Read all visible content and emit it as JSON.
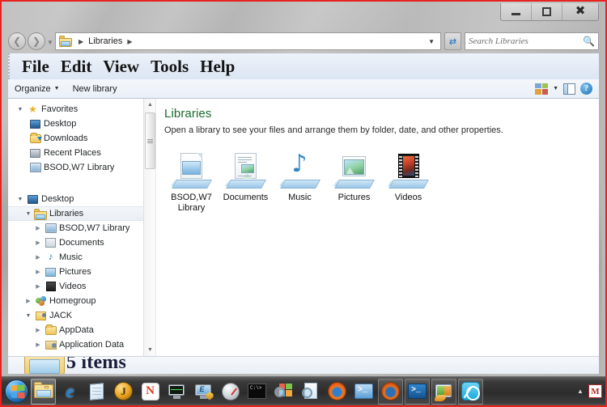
{
  "window": {
    "titlebar": {
      "minimize_label": "Minimize",
      "maximize_label": "Restore",
      "close_label": "Close"
    }
  },
  "address_bar": {
    "back_label": "Back",
    "forward_label": "Forward",
    "breadcrumb": [
      "Libraries"
    ],
    "crumb_text": "Libraries",
    "refresh_label": "Refresh",
    "search": {
      "placeholder": "Search Libraries",
      "value": ""
    }
  },
  "menu_bar": {
    "items": [
      {
        "label": "File"
      },
      {
        "label": "Edit"
      },
      {
        "label": "View"
      },
      {
        "label": "Tools"
      },
      {
        "label": "Help"
      }
    ]
  },
  "toolbar": {
    "organize_label": "Organize",
    "new_library_label": "New library",
    "view_icon": "view-layout-icon",
    "preview_pane_icon": "preview-pane-icon",
    "help_icon": "help-icon",
    "help_glyph": "?"
  },
  "sidebar": {
    "items": [
      {
        "label": "Favorites",
        "icon": "star-icon",
        "indent": 0,
        "expander": "open",
        "selected": false
      },
      {
        "label": "Desktop",
        "icon": "monitor-icon",
        "indent": 1,
        "expander": "none",
        "selected": false
      },
      {
        "label": "Downloads",
        "icon": "downloads-folder-icon",
        "indent": 1,
        "expander": "none",
        "selected": false
      },
      {
        "label": "Recent Places",
        "icon": "recent-places-icon",
        "indent": 1,
        "expander": "none",
        "selected": false
      },
      {
        "label": "BSOD,W7 Library",
        "icon": "library-icon",
        "indent": 1,
        "expander": "none",
        "selected": false
      },
      {
        "label": "",
        "icon": "spacer",
        "indent": 0,
        "expander": "none",
        "selected": false
      },
      {
        "label": "Desktop",
        "icon": "monitor-icon",
        "indent": 0,
        "expander": "open",
        "selected": false
      },
      {
        "label": "Libraries",
        "icon": "libraries-icon",
        "indent": 1,
        "expander": "open",
        "selected": true
      },
      {
        "label": "BSOD,W7 Library",
        "icon": "library-icon",
        "indent": 2,
        "expander": "closed",
        "selected": false
      },
      {
        "label": "Documents",
        "icon": "documents-library-icon",
        "indent": 2,
        "expander": "closed",
        "selected": false
      },
      {
        "label": "Music",
        "icon": "music-library-icon",
        "indent": 2,
        "expander": "closed",
        "selected": false
      },
      {
        "label": "Pictures",
        "icon": "pictures-library-icon",
        "indent": 2,
        "expander": "closed",
        "selected": false
      },
      {
        "label": "Videos",
        "icon": "videos-library-icon",
        "indent": 2,
        "expander": "closed",
        "selected": false
      },
      {
        "label": "Homegroup",
        "icon": "homegroup-icon",
        "indent": 1,
        "expander": "closed",
        "selected": false
      },
      {
        "label": "JACK",
        "icon": "user-folder-icon",
        "indent": 1,
        "expander": "open",
        "selected": false
      },
      {
        "label": "AppData",
        "icon": "folder-icon",
        "indent": 2,
        "expander": "closed",
        "selected": false
      },
      {
        "label": "Application Data",
        "icon": "junction-folder-icon",
        "indent": 2,
        "expander": "closed",
        "selected": false
      }
    ],
    "scrollbar": {
      "up_arrow": "scroll-up-arrow",
      "down_arrow": "scroll-down-arrow"
    }
  },
  "content": {
    "title": "Libraries",
    "subtitle": "Open a library to see your files and arrange them by folder, date, and other properties.",
    "tiles": [
      {
        "label": "BSOD,W7 Library",
        "icon": "library-tile-icon"
      },
      {
        "label": "Documents",
        "icon": "documents-tile-icon"
      },
      {
        "label": "Music",
        "icon": "music-tile-icon"
      },
      {
        "label": "Pictures",
        "icon": "pictures-tile-icon"
      },
      {
        "label": "Videos",
        "icon": "videos-tile-icon"
      }
    ]
  },
  "status_bar": {
    "text": "5 items",
    "icon": "libraries-folder-icon"
  },
  "taskbar": {
    "start_label": "Start",
    "buttons": [
      {
        "name": "taskbar-windows-explorer",
        "icon": "explorer-icon",
        "state": "active"
      },
      {
        "name": "taskbar-internet-explorer",
        "icon": "internet-explorer-icon",
        "state": "pinned"
      },
      {
        "name": "taskbar-notepad",
        "icon": "notepad-icon",
        "state": "pinned"
      },
      {
        "name": "taskbar-jdownloader",
        "icon": "j-circle-icon",
        "state": "pinned"
      },
      {
        "name": "taskbar-nero",
        "icon": "n-red-icon",
        "state": "pinned"
      },
      {
        "name": "taskbar-task-manager",
        "icon": "task-manager-icon",
        "state": "pinned"
      },
      {
        "name": "taskbar-msconfig",
        "icon": "system-config-icon",
        "state": "pinned"
      },
      {
        "name": "taskbar-performance",
        "icon": "gauge-icon",
        "state": "pinned"
      },
      {
        "name": "taskbar-command-prompt",
        "icon": "command-prompt-icon",
        "state": "pinned"
      },
      {
        "name": "taskbar-windows-search",
        "icon": "windows-search-icon",
        "state": "pinned"
      },
      {
        "name": "taskbar-magnifier",
        "icon": "magnifier-doc-icon",
        "state": "pinned"
      },
      {
        "name": "taskbar-firefox",
        "icon": "firefox-icon",
        "state": "pinned"
      },
      {
        "name": "taskbar-powershell",
        "icon": "powershell-icon",
        "state": "pinned"
      },
      {
        "name": "taskbar-firefox-window",
        "icon": "firefox-icon",
        "state": "running"
      },
      {
        "name": "taskbar-powershell-window",
        "icon": "powershell-blue-icon",
        "state": "running"
      },
      {
        "name": "taskbar-live-mail",
        "icon": "windows-live-mail-icon",
        "state": "running"
      },
      {
        "name": "taskbar-zoomit",
        "icon": "zoomit-icon",
        "state": "running"
      }
    ],
    "tray": {
      "show_hidden_icon": "show-hidden-icons-arrow",
      "items": [
        {
          "name": "tray-malwarebytes",
          "glyph": "M"
        }
      ]
    }
  }
}
